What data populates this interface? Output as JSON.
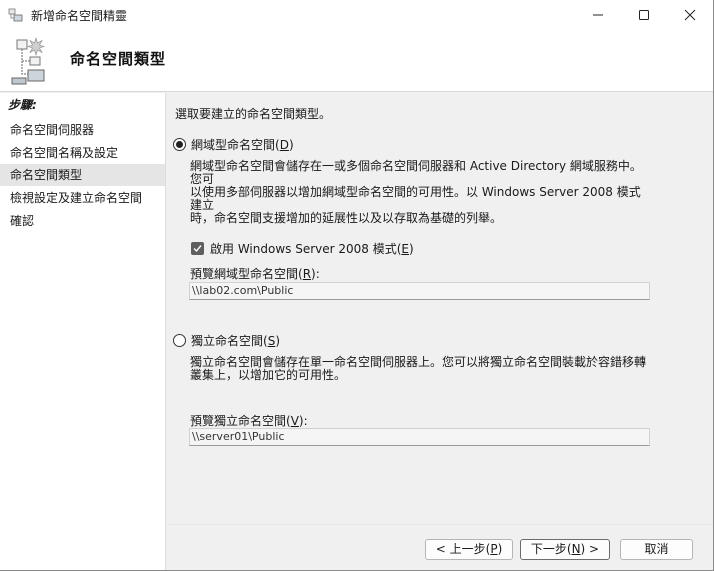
{
  "window": {
    "title": "新增命名空間精靈"
  },
  "header": {
    "title": "命名空間類型"
  },
  "steps": {
    "title": "步驟:",
    "items": [
      {
        "label": "命名空間伺服器"
      },
      {
        "label": "命名空間名稱及設定"
      },
      {
        "label": "命名空間類型"
      },
      {
        "label": "檢視設定及建立命名空間"
      },
      {
        "label": "確認"
      }
    ],
    "active_index": 2
  },
  "main": {
    "intro": "選取要建立的命名空間類型。",
    "domain_option": {
      "label_text": "網域型命名空間(",
      "accel": "D",
      "label_end": ")",
      "selected": true,
      "description_lines": [
        "網域型命名空間會儲存在一或多個命名空間伺服器和 Active Directory 網域服務中。您可",
        "以使用多部伺服器以增加網域型命名空間的可用性。以 Windows Server 2008 模式建立",
        "時，命名空間支援增加的延展性以及以存取為基礎的列舉。"
      ],
      "checkbox_text": "啟用 Windows Server 2008 模式(",
      "checkbox_accel": "E",
      "checkbox_end": ")",
      "checkbox_checked": true,
      "preview_label_text": "預覽網域型命名空間(",
      "preview_label_accel": "R",
      "preview_label_end": "):",
      "preview_value": "\\\\lab02.com\\Public"
    },
    "standalone_option": {
      "label_text": "獨立命名空間(",
      "accel": "S",
      "label_end": ")",
      "selected": false,
      "description_lines": [
        "獨立命名空間會儲存在單一命名空間伺服器上。您可以將獨立命名空間裝載於容錯移轉",
        "叢集上，以增加它的可用性。"
      ],
      "preview_label_text": "預覽獨立命名空間(",
      "preview_label_accel": "V",
      "preview_label_end": "):",
      "preview_value": "\\\\server01\\Public"
    }
  },
  "buttons": {
    "back": {
      "pre": "< 上一步(",
      "accel": "P",
      "post": ")"
    },
    "next": {
      "pre": "下一步(",
      "accel": "N",
      "post": ") >"
    },
    "cancel": "取消"
  },
  "colors": {
    "accent": "#5f5f5f",
    "active_step": "#e5e5e5"
  },
  "icons": {
    "app": "namespace-wizard-icon",
    "header": "namespace-tree-icon",
    "minimize": "minimize-icon",
    "maximize": "maximize-icon",
    "close": "close-icon",
    "check": "checkmark-icon"
  }
}
